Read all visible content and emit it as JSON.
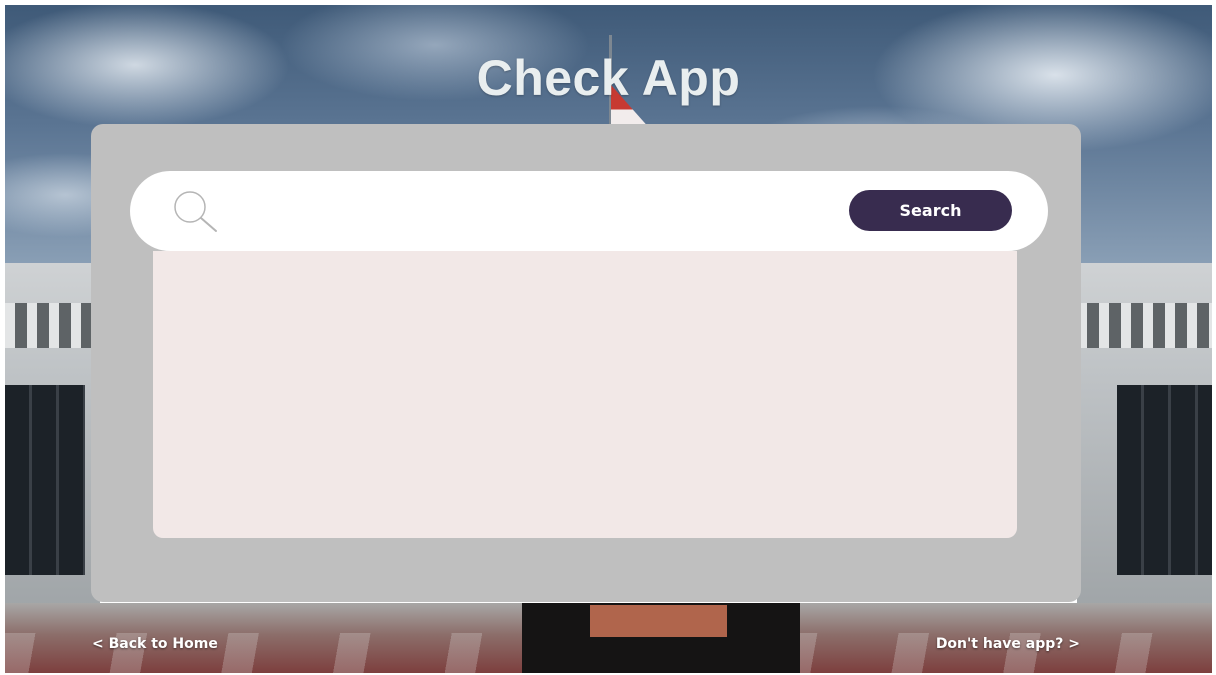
{
  "header": {
    "title": "Check App"
  },
  "search": {
    "placeholder": "",
    "value": "",
    "button_label": "Search",
    "icon": "search-icon"
  },
  "results": {
    "items": []
  },
  "footer": {
    "back_label": "< Back to Home",
    "no_app_label": "Don't have app? >"
  },
  "colors": {
    "button": "#382c4f",
    "panel": "#bfbfbf",
    "results_bg": "#f2e8e7",
    "title": "#e9eeef"
  }
}
